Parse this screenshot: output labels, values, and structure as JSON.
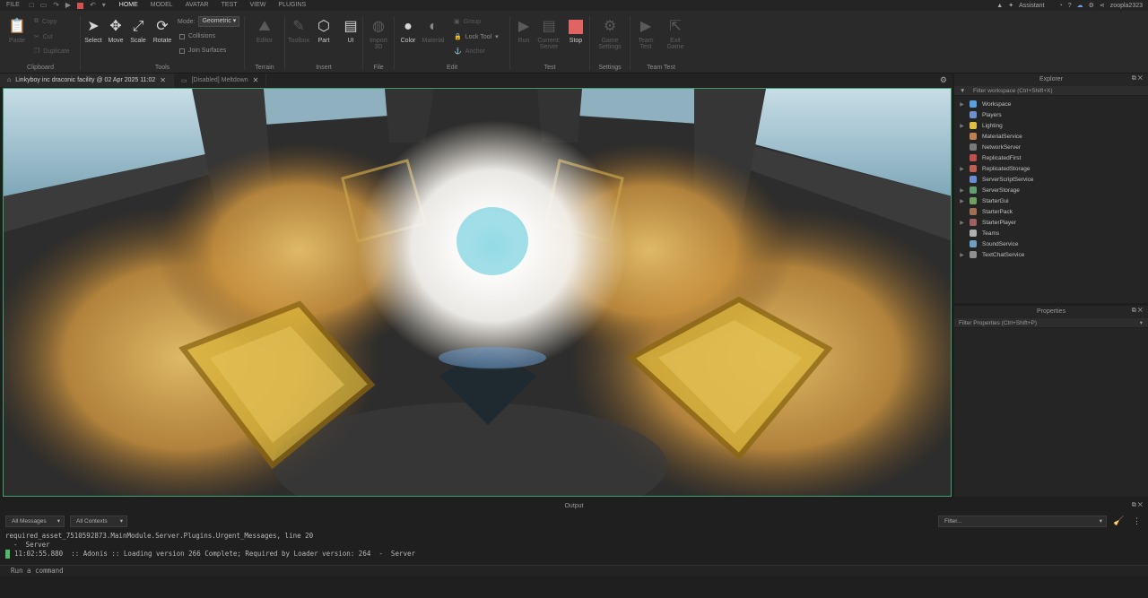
{
  "menubar": {
    "items": [
      "FILE",
      "HOME",
      "MODEL",
      "AVATAR",
      "TEST",
      "VIEW",
      "PLUGINS"
    ],
    "active": "HOME",
    "assistant": "Assistant",
    "username": "zoopla2323"
  },
  "ribbon": {
    "clipboard": {
      "label": "Clipboard",
      "paste": "Paste",
      "copy": "Copy",
      "cut": "Cut",
      "duplicate": "Duplicate"
    },
    "tools": {
      "label": "Tools",
      "select": "Select",
      "move": "Move",
      "scale": "Scale",
      "rotate": "Rotate",
      "mode_label": "Mode:",
      "mode_value": "Geometric",
      "collisions": "Collisions",
      "join_surfaces": "Join Surfaces"
    },
    "terrain": {
      "label": "Terrain",
      "editor": "Editor"
    },
    "insert": {
      "label": "Insert",
      "toolbox": "Toolbox",
      "part": "Part",
      "ui": "UI"
    },
    "file": {
      "label": "File",
      "import3d": "Import 3D"
    },
    "edit": {
      "label": "Edit",
      "color": "Color",
      "material": "Material",
      "group": "Group",
      "lock_tool": "Lock Tool",
      "anchor": "Anchor"
    },
    "test": {
      "label": "Test",
      "run": "Run",
      "current_server": "Current: Server",
      "stop": "Stop"
    },
    "settings": {
      "label": "Settings",
      "game_settings": "Game Settings"
    },
    "team_test": {
      "label": "Team Test",
      "team_test": "Team Test",
      "exit_game": "Exit Game"
    }
  },
  "tabs": [
    {
      "label": "Linkyboy inc draconic facility @ 02 Apr 2025 11:02",
      "active": true
    },
    {
      "label": "[Disabled] Meltdown",
      "active": false
    }
  ],
  "explorer": {
    "title": "Explorer",
    "filter_placeholder": "Filter workspace (Ctrl+Shift+X)",
    "items": [
      {
        "label": "Workspace",
        "expandable": true,
        "icon_color": "#5aa0e0"
      },
      {
        "label": "Players",
        "expandable": false,
        "icon_color": "#6f8fd0"
      },
      {
        "label": "Lighting",
        "expandable": true,
        "icon_color": "#e0c040"
      },
      {
        "label": "MaterialService",
        "expandable": false,
        "icon_color": "#c08050"
      },
      {
        "label": "NetworkServer",
        "expandable": false,
        "icon_color": "#7a7a7a"
      },
      {
        "label": "ReplicatedFirst",
        "expandable": false,
        "icon_color": "#c05050"
      },
      {
        "label": "ReplicatedStorage",
        "expandable": true,
        "icon_color": "#c06050"
      },
      {
        "label": "ServerScriptService",
        "expandable": false,
        "icon_color": "#6c8cd0"
      },
      {
        "label": "ServerStorage",
        "expandable": true,
        "icon_color": "#60a070"
      },
      {
        "label": "StarterGui",
        "expandable": true,
        "icon_color": "#70a060"
      },
      {
        "label": "StarterPack",
        "expandable": false,
        "icon_color": "#a07050"
      },
      {
        "label": "StarterPlayer",
        "expandable": true,
        "icon_color": "#a06060"
      },
      {
        "label": "Teams",
        "expandable": false,
        "icon_color": "#b0b0b0"
      },
      {
        "label": "SoundService",
        "expandable": false,
        "icon_color": "#70a0c0"
      },
      {
        "label": "TextChatService",
        "expandable": true,
        "icon_color": "#909090"
      }
    ]
  },
  "properties": {
    "title": "Properties",
    "filter_placeholder": "Filter Properties (Ctrl+Shift+P)"
  },
  "output": {
    "title": "Output",
    "messages_filter": "All Messages",
    "contexts_filter": "All Contexts",
    "filter_placeholder": "Filter...",
    "lines": [
      "required_asset_7510592873.MainModule.Server.Plugins.Urgent_Messages, line 20",
      "  -  Server",
      "11:02:55.880  :: Adonis :: Loading version 266 Complete; Required by Loader version: 264  -  Server"
    ],
    "command_placeholder": "Run a command"
  }
}
